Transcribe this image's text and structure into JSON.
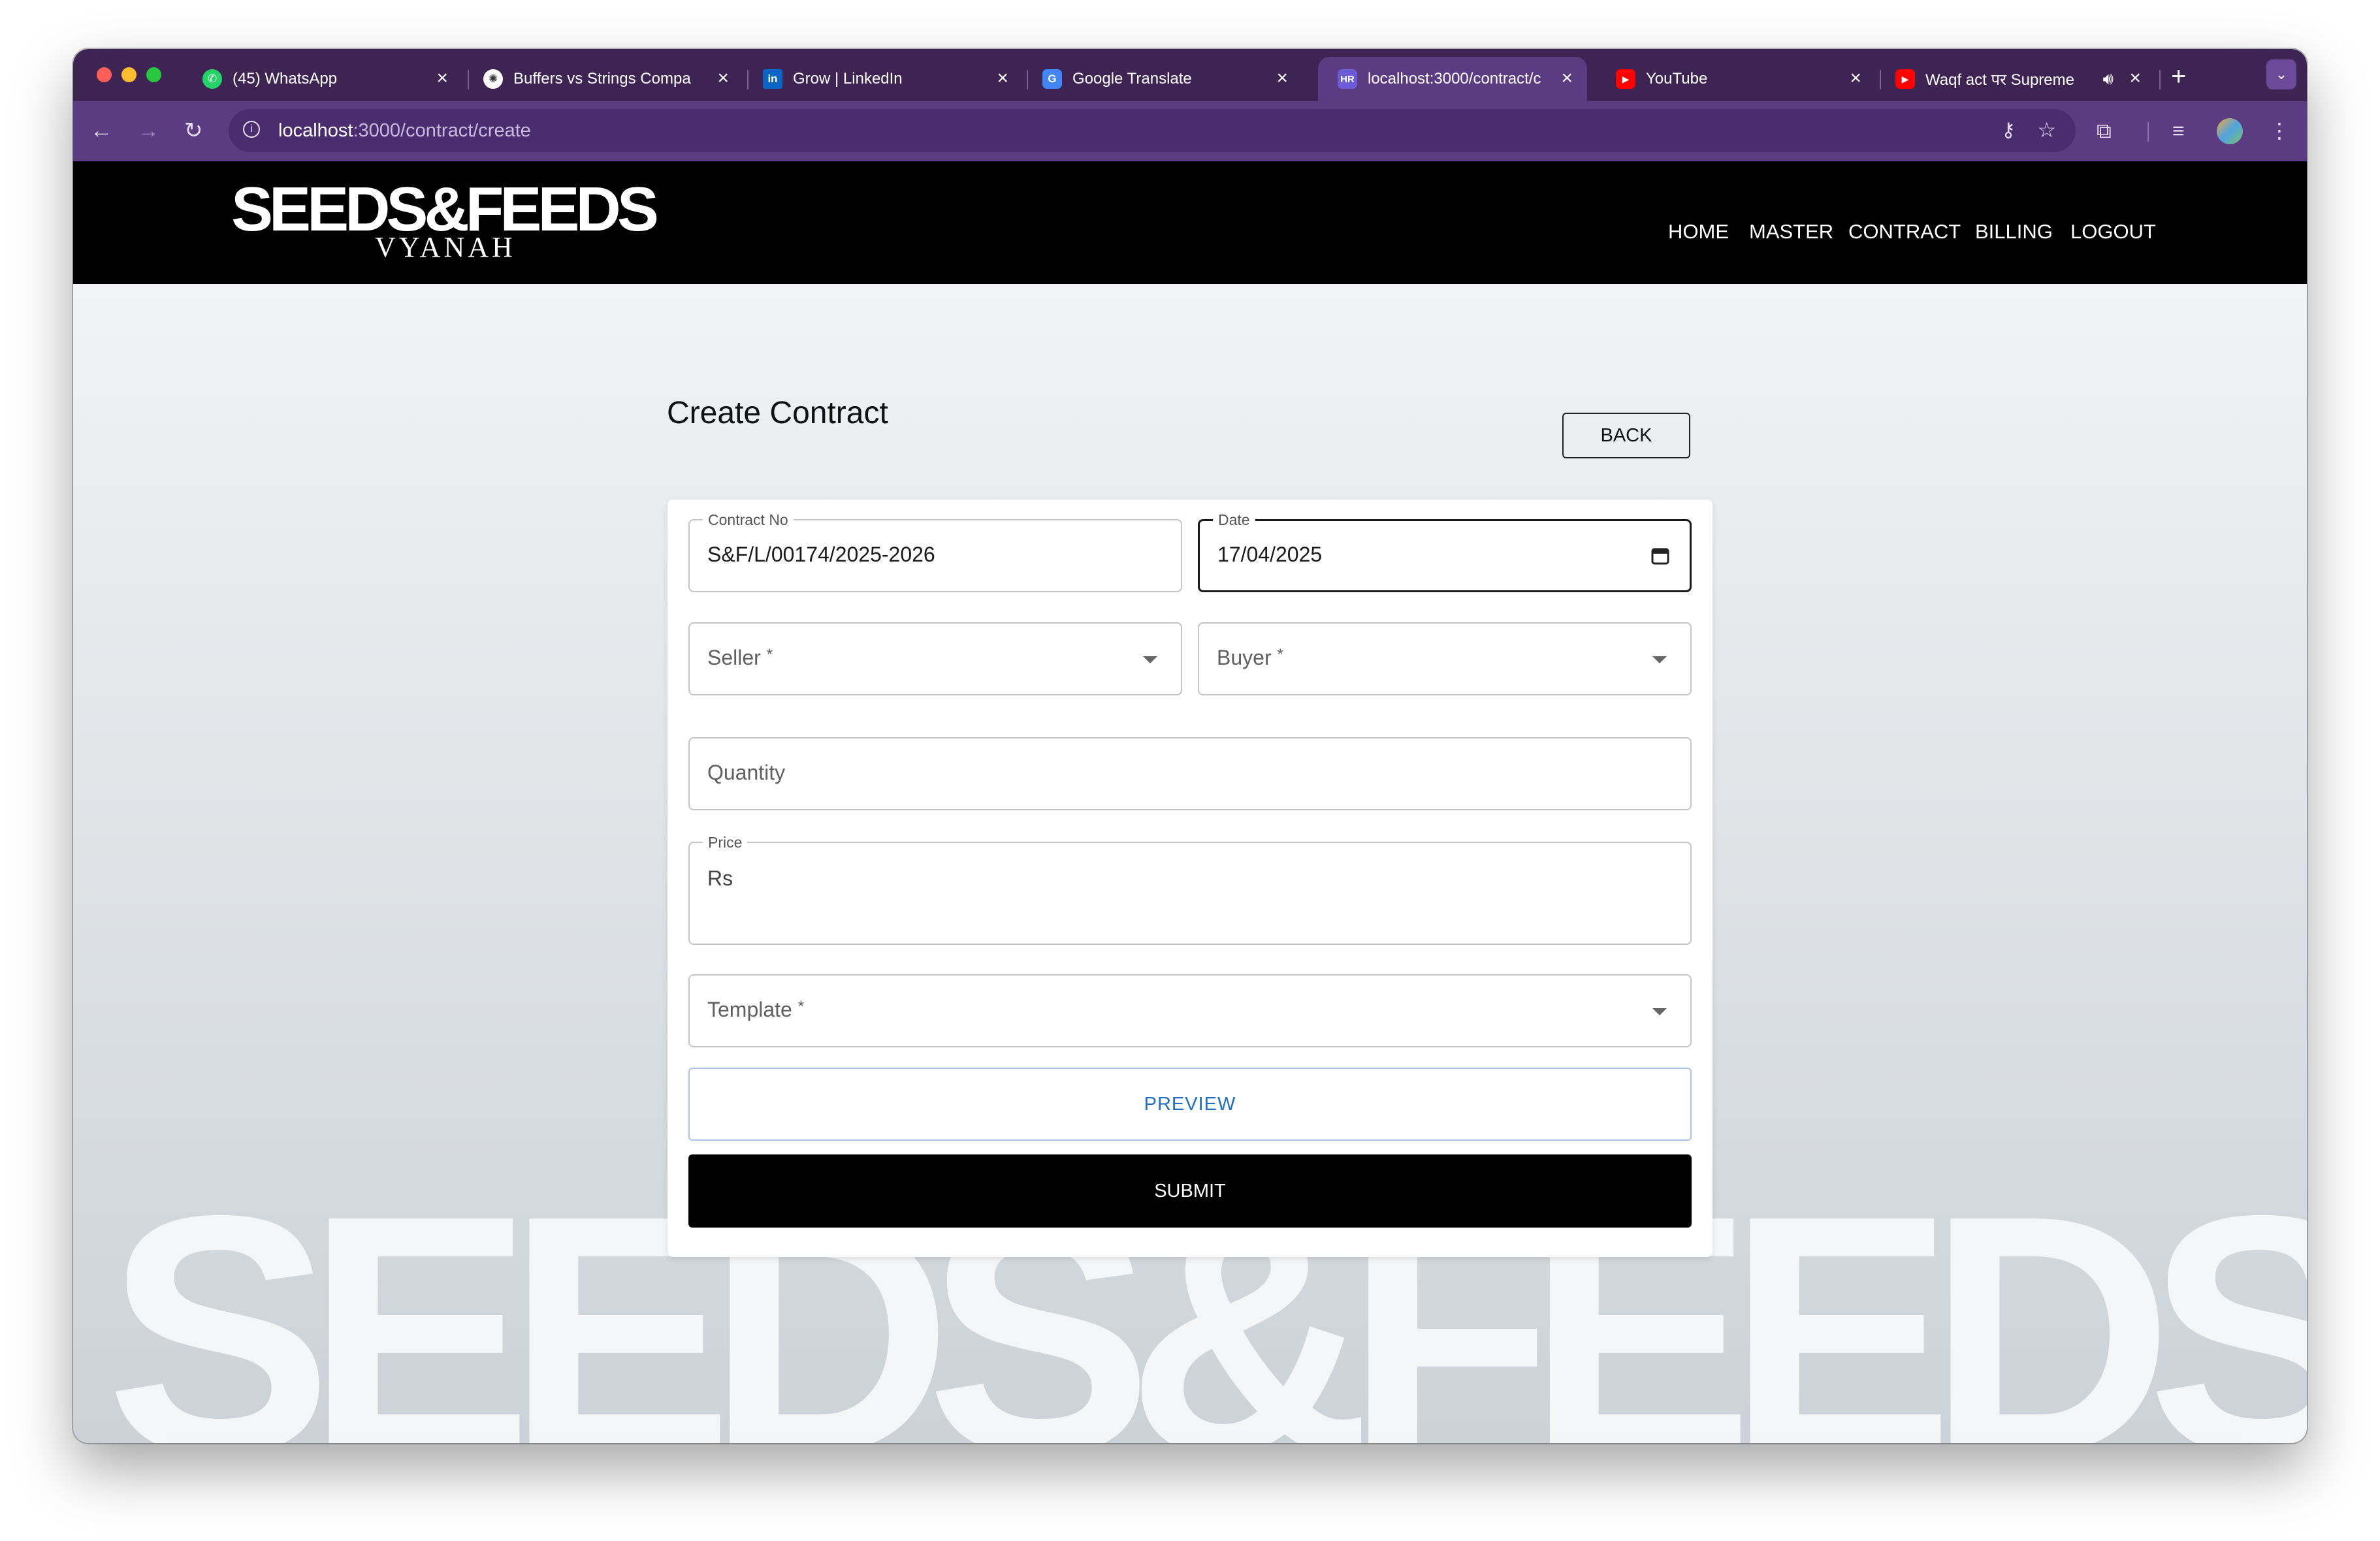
{
  "window": {
    "traffic_colors": [
      "#ff5f57",
      "#febc2e",
      "#28c840"
    ]
  },
  "tabs": [
    {
      "title": "(45) WhatsApp",
      "icon": "whatsapp-icon",
      "color": "#25d366",
      "glyph": "✆"
    },
    {
      "title": "Buffers vs Strings Compa",
      "icon": "chatgpt-icon",
      "color": "#2b2b2b",
      "glyph": "✺"
    },
    {
      "title": "Grow | LinkedIn",
      "icon": "linkedin-icon",
      "color": "#0a66c2",
      "glyph": "in"
    },
    {
      "title": "Google Translate",
      "icon": "google-translate-icon",
      "color": "#4285f4",
      "glyph": "G"
    },
    {
      "title": "localhost:3000/contract/c",
      "icon": "hr-app-icon",
      "color": "#6b5bd6",
      "glyph": "HR",
      "active": true
    },
    {
      "title": "YouTube",
      "icon": "youtube-icon",
      "color": "#ff0000",
      "glyph": "▶"
    },
    {
      "title": "Waqf act पर Supreme",
      "icon": "youtube-icon",
      "color": "#ff0000",
      "glyph": "▶"
    }
  ],
  "browser": {
    "url_host": "localhost",
    "url_path": ":3000/contract/create"
  },
  "site": {
    "logo_main": "SEEDS&FEEDS",
    "logo_sub": "VYANAH",
    "nav": [
      "HOME",
      "MASTER",
      "CONTRACT",
      "BILLING",
      "LOGOUT"
    ],
    "watermark": "SEEDS&FEEDS"
  },
  "page": {
    "title": "Create Contract",
    "back_label": "BACK"
  },
  "form": {
    "contract_no": {
      "label": "Contract No",
      "value": "S&F/L/00174/2025-2026"
    },
    "date": {
      "label": "Date",
      "value": "17/04/2025"
    },
    "seller": {
      "placeholder": "Seller",
      "required": "*"
    },
    "buyer": {
      "placeholder": "Buyer",
      "required": "*"
    },
    "quantity": {
      "placeholder": "Quantity"
    },
    "price": {
      "label": "Price",
      "value": "Rs"
    },
    "template": {
      "placeholder": "Template",
      "required": "*"
    },
    "preview_label": "PREVIEW",
    "submit_label": "SUBMIT"
  },
  "colors": {
    "tab_strip": "#3e2452",
    "toolbar": "#5b3b82",
    "navbar": "#000000",
    "accent_blue": "#1f6fc7"
  }
}
